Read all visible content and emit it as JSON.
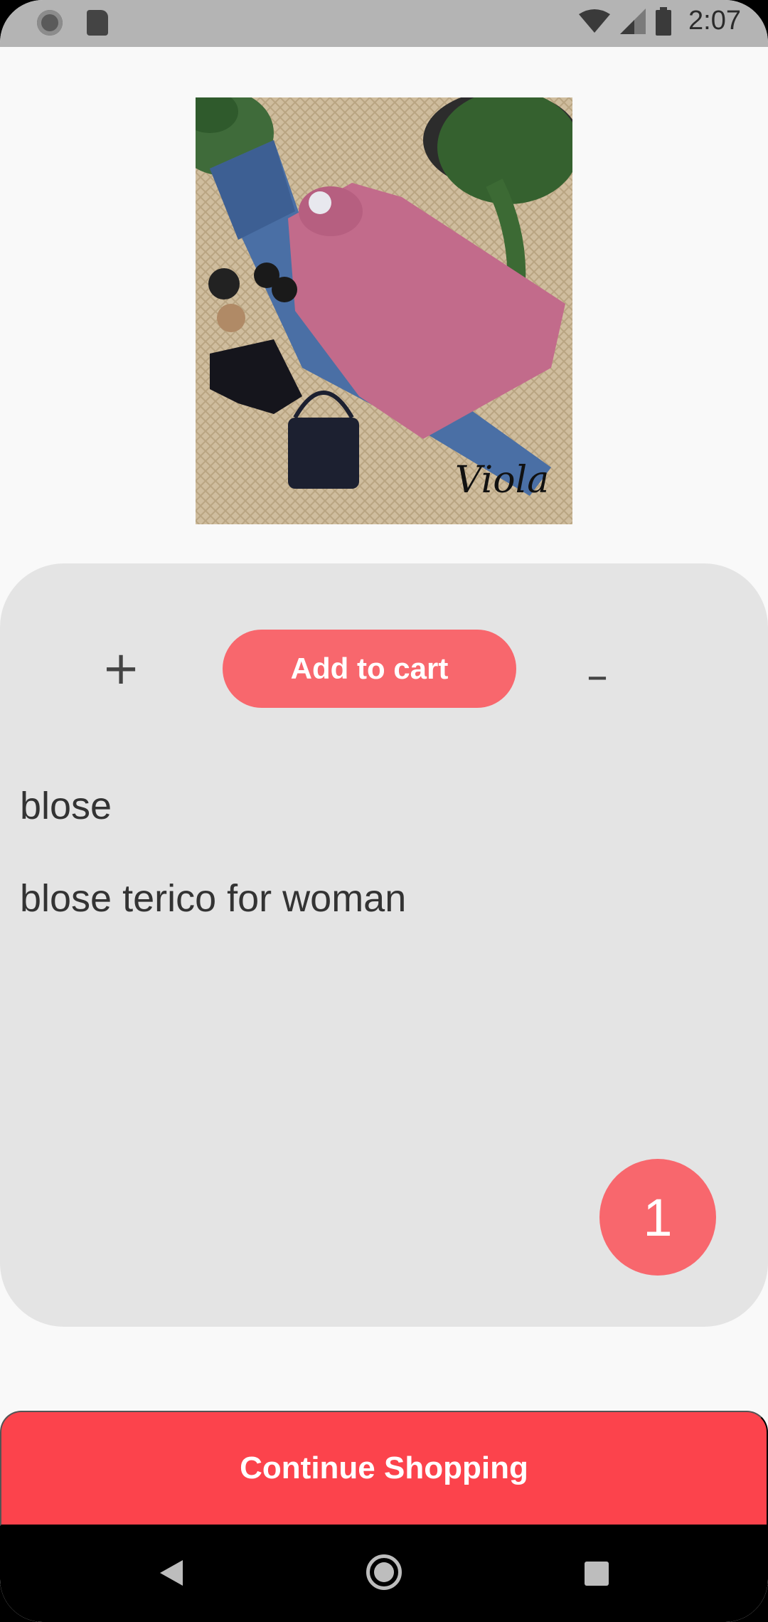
{
  "status_bar": {
    "time": "2:07"
  },
  "product": {
    "image_watermark": "Viola",
    "name": "blose",
    "description": "blose terico for woman"
  },
  "actions": {
    "plus_label": "+",
    "add_to_cart_label": "Add to cart",
    "minus_label": "–",
    "quantity": "1",
    "continue_label": "Continue Shopping"
  },
  "colors": {
    "accent": "#f8676d",
    "primary_button": "#fc434c",
    "card_bg": "#e4e4e4"
  },
  "icons": {
    "status_left": [
      "sync-icon",
      "sd-card-icon"
    ],
    "status_right": [
      "wifi-icon",
      "signal-icon",
      "battery-icon"
    ],
    "nav": [
      "back-icon",
      "home-icon",
      "recents-icon"
    ]
  }
}
